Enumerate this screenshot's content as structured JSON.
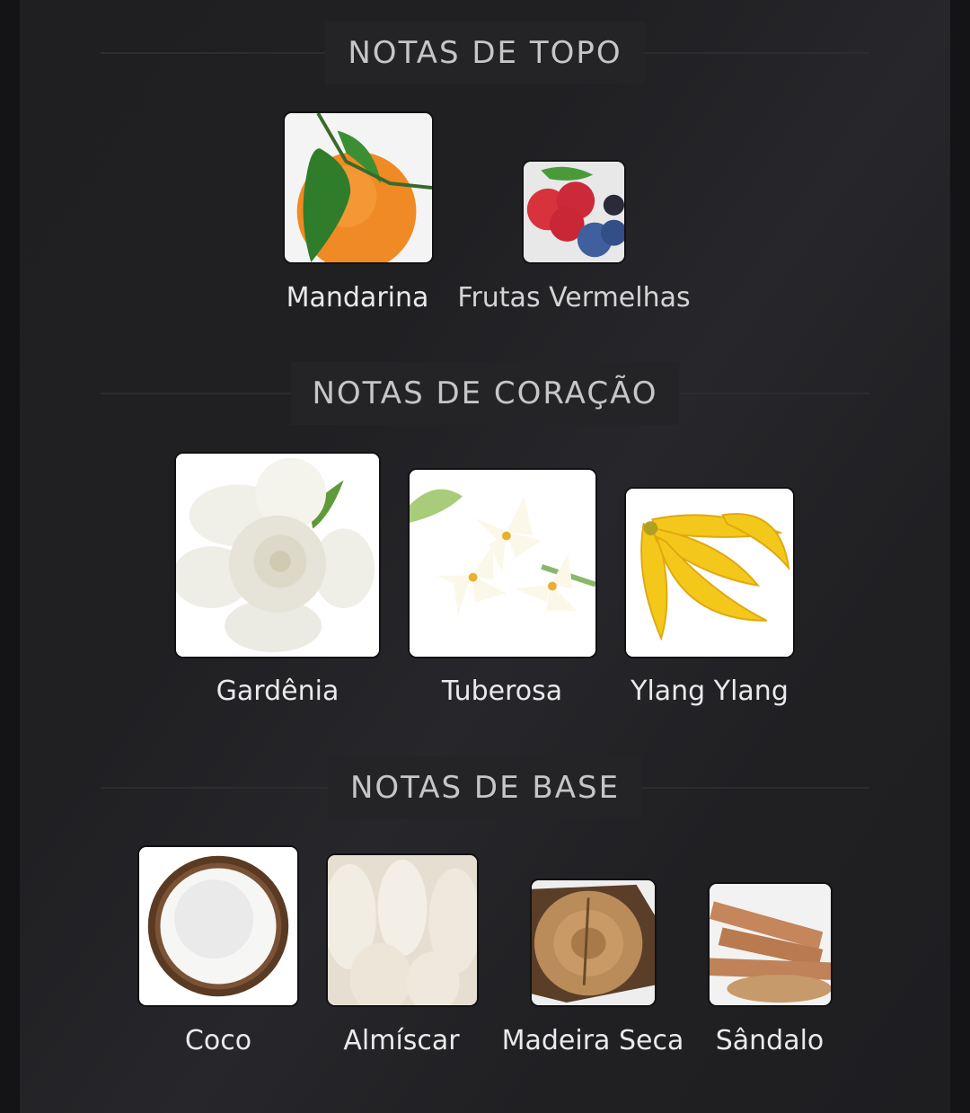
{
  "sections": [
    {
      "title": "NOTAS DE TOPO",
      "notes": [
        {
          "name": "Mandarina",
          "icon": "mandarin-icon"
        },
        {
          "name": "Frutas Vermelhas",
          "icon": "red-berries-icon"
        }
      ]
    },
    {
      "title": "NOTAS DE CORAÇÃO",
      "notes": [
        {
          "name": "Gardênia",
          "icon": "gardenia-icon"
        },
        {
          "name": "Tuberosa",
          "icon": "tuberose-icon"
        },
        {
          "name": "Ylang Ylang",
          "icon": "ylang-ylang-icon"
        }
      ]
    },
    {
      "title": "NOTAS DE BASE",
      "notes": [
        {
          "name": "Coco",
          "icon": "coconut-icon"
        },
        {
          "name": "Almíscar",
          "icon": "musk-icon"
        },
        {
          "name": "Madeira Seca",
          "icon": "dry-wood-icon"
        },
        {
          "name": "Sândalo",
          "icon": "sandalwood-icon"
        }
      ]
    }
  ]
}
